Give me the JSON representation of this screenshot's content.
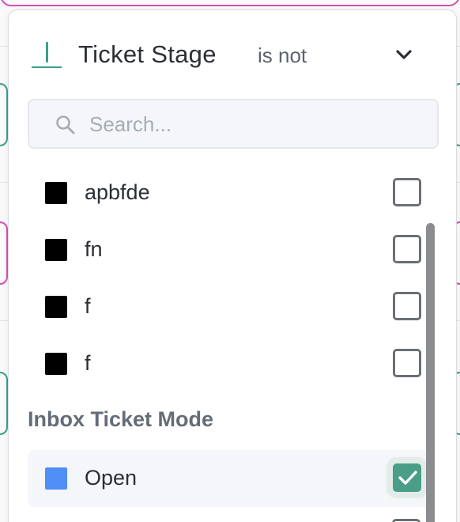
{
  "filter": {
    "field_label": "Ticket Stage",
    "operator": "is not",
    "field_icon": "text-field-icon",
    "accent_color": "#39a08a"
  },
  "search": {
    "placeholder": "Search...",
    "value": ""
  },
  "options": [
    {
      "label": "apbfde",
      "color": "#000000",
      "checked": false
    },
    {
      "label": "fn",
      "color": "#000000",
      "checked": false
    },
    {
      "label": "f",
      "color": "#000000",
      "checked": false
    },
    {
      "label": "f",
      "color": "#000000",
      "checked": false
    }
  ],
  "group": {
    "heading": "Inbox Ticket Mode",
    "options": [
      {
        "label": "Open",
        "color": "#4f8ff7",
        "checked": true
      }
    ]
  },
  "colors": {
    "checkbox_checked": "#4a9e87",
    "swatch_open": "#4f8ff7"
  }
}
